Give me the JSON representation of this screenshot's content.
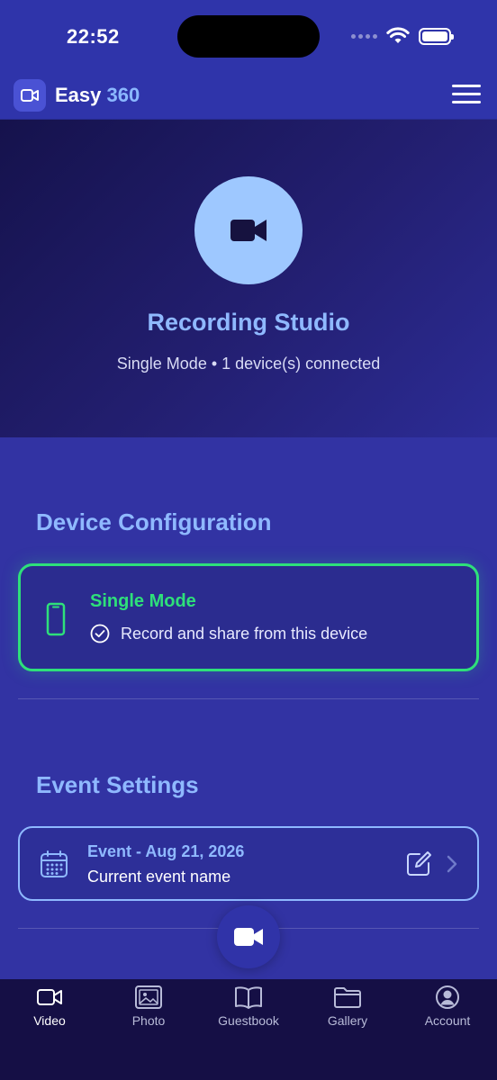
{
  "status_bar": {
    "time": "22:52"
  },
  "header": {
    "title_main": "Easy",
    "title_accent": "360",
    "logo_icon": "video-camera-icon",
    "menu_icon": "hamburger-menu-icon"
  },
  "hero": {
    "icon": "video-camera-icon",
    "title": "Recording Studio",
    "subtitle": "Single Mode • 1 device(s) connected"
  },
  "device_config": {
    "title": "Device Configuration",
    "mode_card": {
      "icon": "phone-icon",
      "title": "Single Mode",
      "description": "Record and share from this device",
      "status_icon": "check-circle-icon"
    }
  },
  "event_settings": {
    "title": "Event Settings",
    "event_card": {
      "icon": "calendar-icon",
      "title": "Event - Aug 21, 2026",
      "subtitle": "Current event name",
      "edit_icon": "edit-icon",
      "chevron_icon": "chevron-right-icon"
    }
  },
  "fab": {
    "icon": "video-camera-icon"
  },
  "tabs": [
    {
      "label": "Video",
      "icon": "video-icon",
      "active": true
    },
    {
      "label": "Photo",
      "icon": "photo-icon",
      "active": false
    },
    {
      "label": "Guestbook",
      "icon": "book-icon",
      "active": false
    },
    {
      "label": "Gallery",
      "icon": "folder-icon",
      "active": false
    },
    {
      "label": "Account",
      "icon": "account-icon",
      "active": false
    }
  ],
  "colors": {
    "accent_blue": "#8fb9ff",
    "success_green": "#2ee07a",
    "background": "#3233a3",
    "tab_bar": "#150f45"
  }
}
